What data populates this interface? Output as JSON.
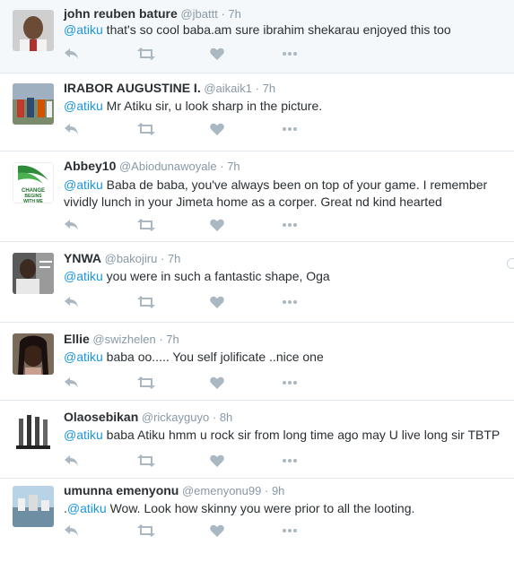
{
  "tweets": [
    {
      "name": "john reuben bature",
      "handle": "@jbattt",
      "sep": "·",
      "time": "7h",
      "prefix": "",
      "mention": "@atiku",
      "lines": [
        " that's so cool baba.am sure ibrahim shekarau enjoyed this too"
      ]
    },
    {
      "name": "IRABOR AUGUSTINE I.",
      "handle": "@aikaik1",
      "sep": "·",
      "time": "7h",
      "prefix": "",
      "mention": "@atiku",
      "lines": [
        " Mr Atiku sir, u look sharp in  the picture."
      ]
    },
    {
      "name": "Abbey10",
      "handle": "@Abiodunawoyale",
      "sep": "·",
      "time": "7h",
      "prefix": "",
      "mention": "@atiku",
      "lines": [
        " Baba de baba, you've always been on top of your game. I remember",
        "vividly lunch in your Jimeta home as a corper. Great nd kind hearted"
      ],
      "avatar_text": "CHANGE BEGINS WITH ME"
    },
    {
      "name": "YNWA",
      "handle": "@bakojiru",
      "sep": "·",
      "time": "7h",
      "prefix": "",
      "mention": "@atiku",
      "lines": [
        " you were in such a fantastic shape, Oga"
      ]
    },
    {
      "name": "Ellie",
      "handle": "@swizhelen",
      "sep": "·",
      "time": "7h",
      "prefix": "",
      "mention": "@atiku",
      "lines": [
        " baba oo..... You self jolificate ..nice one"
      ]
    },
    {
      "name": "Olaosebikan",
      "handle": "@rickayguyo",
      "sep": "·",
      "time": "8h",
      "prefix": "",
      "mention": "@atiku",
      "lines": [
        " baba Atiku hmm u rock sir from long time ago may U live long sir TBTP"
      ]
    },
    {
      "name": "umunna emenyonu",
      "handle": "@emenyonu99",
      "sep": "·",
      "time": "9h",
      "prefix": ".",
      "mention": "@atiku",
      "lines": [
        " Wow. Look how skinny you were prior to all the looting."
      ]
    }
  ],
  "colors": {
    "mention": "#1b95e0",
    "muted": "#8899a6",
    "icon": "#aab8c2",
    "name": "#292f33"
  },
  "icons": [
    "reply-icon",
    "retweet-icon",
    "like-icon",
    "more-icon"
  ]
}
